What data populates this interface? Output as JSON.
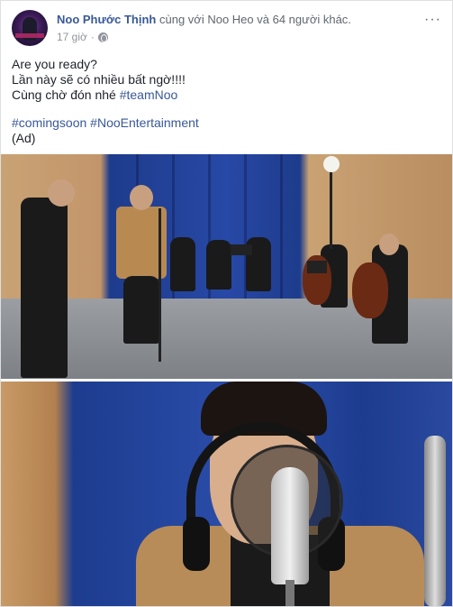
{
  "post": {
    "author": "Noo Phước Thịnh",
    "with_text": "cùng với Noo Heo và 64 người khác.",
    "time": "17 giờ",
    "more_label": "···",
    "lines": [
      "Are you ready?",
      "Lần này sẽ có nhiều bất ngờ!!!!",
      "Cùng chờ đón nhé"
    ],
    "tag_team": "#teamNoo",
    "tag_coming": "#comingsoon",
    "tag_ent": "#NooEntertainment",
    "ad_label": "(Ad)",
    "icons": {
      "privacy": "globe-icon",
      "menu": "more-options-icon"
    },
    "colors": {
      "link": "#385898",
      "meta": "#90949c"
    }
  }
}
